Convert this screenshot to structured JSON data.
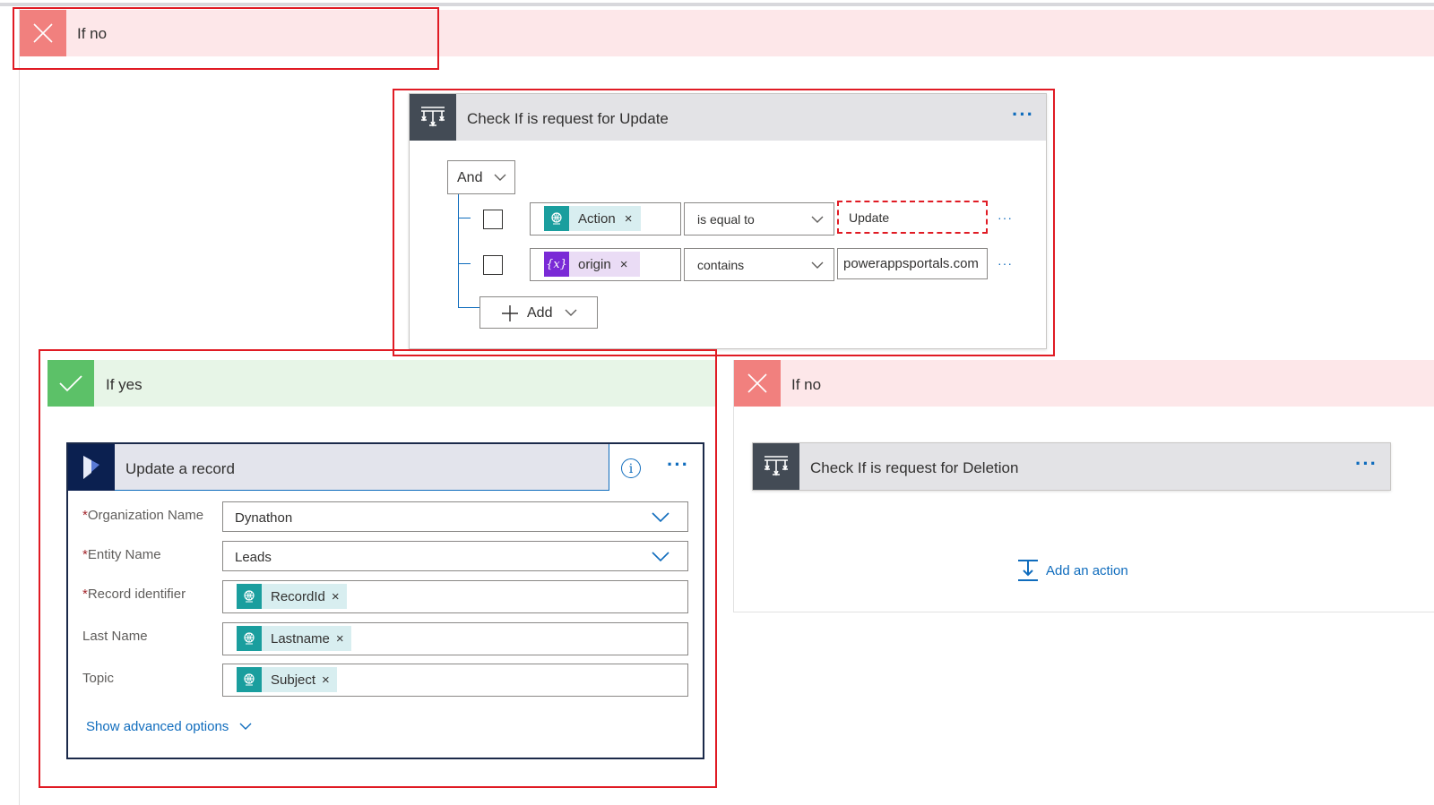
{
  "top_branch": {
    "label": "If no"
  },
  "condition_update": {
    "title": "Check If is request for Update",
    "group_operator": "And",
    "rows": [
      {
        "token": "Action",
        "operator": "is equal to",
        "value": "Update"
      },
      {
        "token": "origin",
        "operator": "contains",
        "value": "powerappsportals.com"
      }
    ],
    "add_label": "Add"
  },
  "yes_branch": {
    "label": "If yes",
    "action": {
      "title": "Update a record",
      "fields": [
        {
          "label": "Organization Name",
          "required": "*",
          "value": "Dynathon"
        },
        {
          "label": "Entity Name",
          "required": "*",
          "value": "Leads"
        },
        {
          "label": "Record identifier",
          "required": "*",
          "token": "RecordId"
        },
        {
          "label": "Last Name",
          "token": "Lastname"
        },
        {
          "label": "Topic",
          "token": "Subject"
        }
      ],
      "advanced_label": "Show advanced options"
    }
  },
  "no_branch": {
    "label": "If no",
    "action_title": "Check If is request for Deletion",
    "add_action_label": "Add an action"
  },
  "icons": {
    "close": "close-icon",
    "check": "checkmark-icon",
    "condition": "condition-icon",
    "dynamics": "dynamics-icon",
    "globe": "globe-icon",
    "variable": "variable-icon"
  },
  "colors": {
    "no_header_bg": "#fde7e9",
    "no_icon_bg": "#f1807e",
    "yes_header_bg": "#e7f5e7",
    "yes_icon_bg": "#5cc168",
    "accent": "#0f6cbd",
    "annotation": "#e01b24"
  }
}
